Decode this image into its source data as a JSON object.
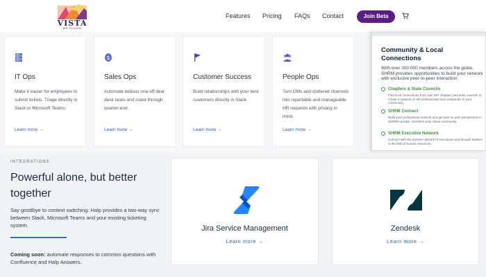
{
  "header": {
    "logo": {
      "word": "VISTA",
      "sub": "WP PLUGIN"
    },
    "nav": [
      "Features",
      "Pricing",
      "FAQs",
      "Contact"
    ],
    "cta": "Join Beta",
    "cart_icon": "cart-icon"
  },
  "cards": [
    {
      "icon": "server-icon",
      "title": "IT Ops",
      "desc": "Make it easier for employees to submit tickets. Triage directly in Slack or Microsoft Teams.",
      "link": "Learn more →"
    },
    {
      "icon": "dollar-icon",
      "title": "Sales Ops",
      "desc": "Automate tedious one-off deal desk tasks and coast through quarter-end.",
      "link": "Learn more →"
    },
    {
      "icon": "flag-icon",
      "title": "Customer Success",
      "desc": "Build relationships with your best customers directly in Slack.",
      "link": "Learn more →"
    },
    {
      "icon": "people-icon",
      "title": "People Ops",
      "desc": "Turn DMs and cluttered channels into reportable and manageable HR requests with privacy in mind.",
      "link": "Learn more →"
    }
  ],
  "popup": {
    "title": "Community & Local Connections",
    "text": "With over 300,000 members across the globe, SHRM provides opportunities to build your network with exclusive peer-to-peer interaction.",
    "items": [
      {
        "label": "Chapters & State Councils",
        "sub": "Find local connections from over 567 chapters and state councils to create a network of HR professionals and companies in your community."
      },
      {
        "label": "SHRM Connect",
        "sub": "Build your professional network and get peer-to-peer perspective in SHRM's private, members-only online community."
      },
      {
        "label": "SHRM Executive Network",
        "sub": "Connect with the premier network of executives and thought leaders in the field of human resources."
      }
    ]
  },
  "integrations": {
    "eyebrow": "INTEGRATIONS",
    "heading": "Powerful alone, but better together",
    "desc": "Say goodbye to context switching. Halp provides a two-way sync between Slack, Microsoft Teams and your existing ticketing system.",
    "soon_label": "Coming soon:",
    "soon_text": " automate responses to common questions with Confluence and Halp Answers.",
    "cards": [
      {
        "icon": "jira-icon",
        "title": "Jira Service Management",
        "link": "Learn more →"
      },
      {
        "icon": "zendesk-icon",
        "title": "Zendesk",
        "link": "Learn more →"
      }
    ]
  },
  "colors": {
    "brand_purple": "#5a1d83",
    "link_blue": "#2b5fb3",
    "jira_blue": "#2684ff",
    "zendesk_green": "#03363d",
    "check_green": "#3c8f3f"
  }
}
